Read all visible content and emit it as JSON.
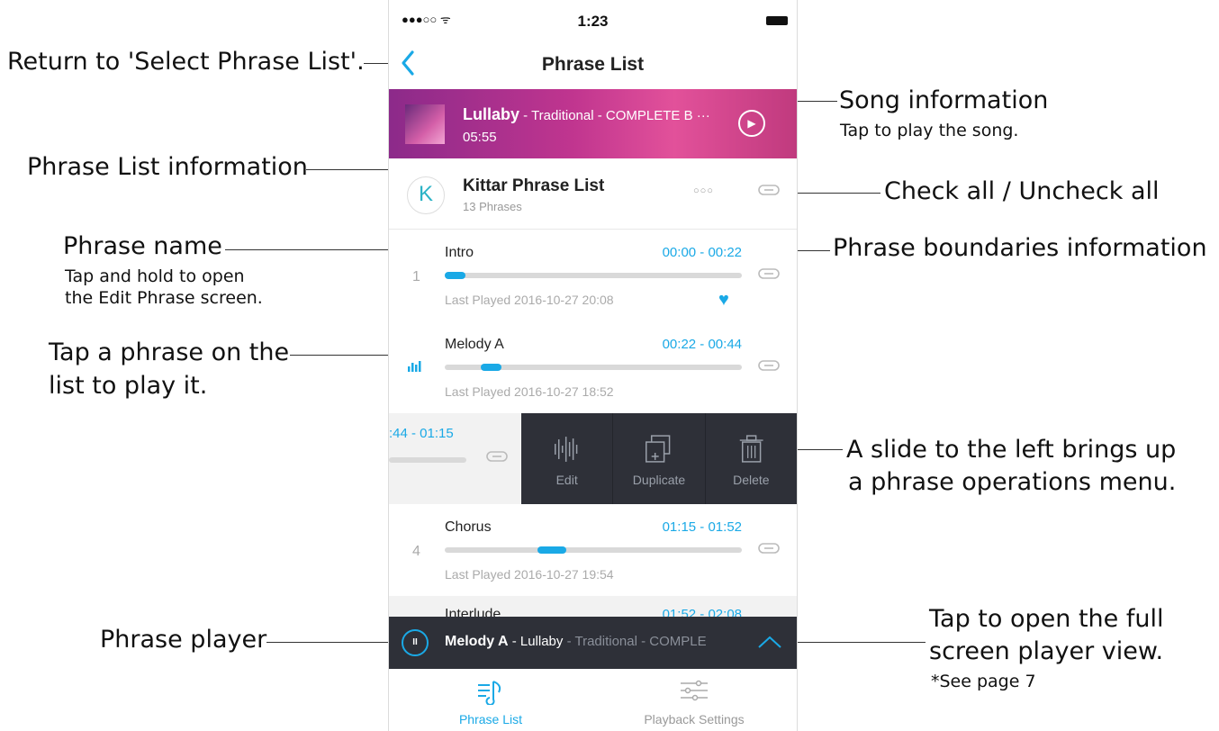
{
  "status_bar": {
    "signal": "●●●○○ ᯤ",
    "time": "1:23"
  },
  "nav": {
    "back_icon": "chevron-left",
    "title": "Phrase List"
  },
  "song": {
    "title": "Lullaby",
    "meta": " - Traditional - COMPLETE B ···",
    "duration": "05:55",
    "play_icon": "play-circle"
  },
  "phrase_list": {
    "name": "Kittar Phrase List",
    "count": "13 Phrases",
    "logo": "K",
    "more": "○○○"
  },
  "phrases": [
    {
      "index": "1",
      "name": "Intro",
      "range": "00:00 - 00:22",
      "last_played": "Last Played 2016-10-27 20:08",
      "favorite": true,
      "progress": [
        0.0,
        0.07
      ]
    },
    {
      "index": "",
      "name": "Melody A",
      "range": "00:22 - 00:44",
      "last_played": "Last Played 2016-10-27 18:52",
      "playing": true,
      "progress": [
        0.12,
        0.19
      ]
    },
    {
      "index": "4",
      "name": "Chorus",
      "range": "01:15 - 01:52",
      "last_played": "Last Played 2016-10-27 19:54",
      "progress": [
        0.31,
        0.41
      ]
    }
  ],
  "swiped_row": {
    "range": ":44 - 01:15"
  },
  "operations": {
    "edit": "Edit",
    "duplicate": "Duplicate",
    "delete": "Delete"
  },
  "partial_row": {
    "name": "Interlude",
    "range": "01:52 - 02:08"
  },
  "player": {
    "phrase": "Melody A",
    "song": " - Lullaby",
    "rest": " - Traditional - COMPLE"
  },
  "tabs": {
    "phrase_list": "Phrase List",
    "playback_settings": "Playback Settings"
  },
  "annotations": {
    "return": "Return to 'Select Phrase List'.",
    "song_info": "Song information",
    "song_info_sub": "Tap to play the song.",
    "phrase_list_info": "Phrase List information",
    "check_all": "Check all / Uncheck all",
    "phrase_name": "Phrase name",
    "phrase_name_sub1": "Tap and hold to open",
    "phrase_name_sub2": "the Edit Phrase screen.",
    "boundaries": "Phrase boundaries information",
    "tap_phrase1": "Tap a phrase on the",
    "tap_phrase2": "list to play it.",
    "slide1": "A slide to the left brings up",
    "slide2": "a phrase operations menu.",
    "player": "Phrase player",
    "full1": "Tap to open the full",
    "full2": "screen player view.",
    "full3": "*See page 7"
  },
  "colors": {
    "accent": "#1aa9e6",
    "dark_panel": "#2e3038",
    "song_banner": "#c0358f"
  }
}
